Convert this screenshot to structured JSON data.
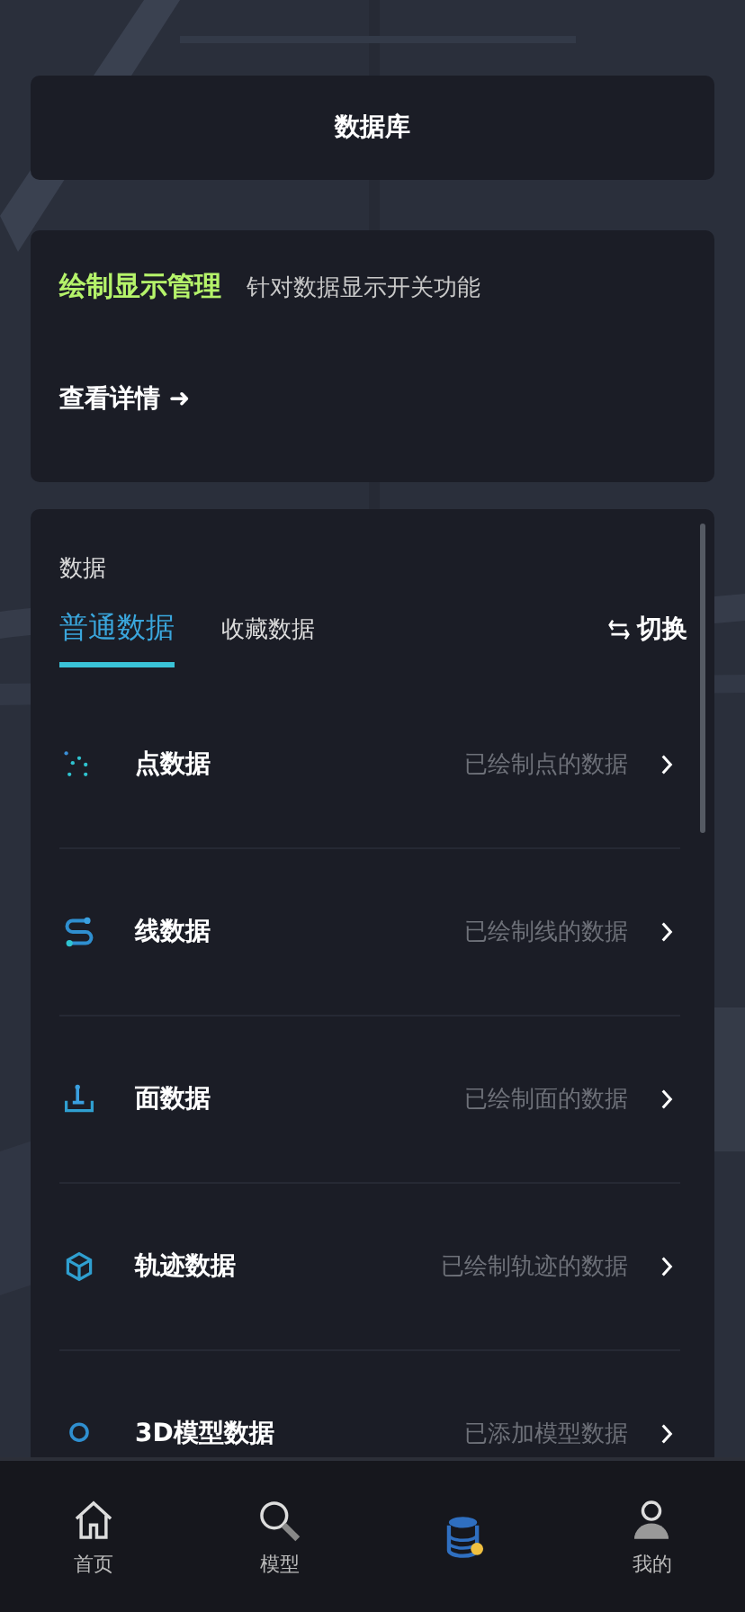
{
  "header": {
    "title": "数据库"
  },
  "banner": {
    "title": "绘制显示管理",
    "subtitle": "针对数据显示开关功能",
    "link": "查看详情",
    "arrow": "➜"
  },
  "panel": {
    "heading": "数据",
    "switch_label": "切换",
    "tabs": [
      {
        "label": "普通数据",
        "selected": true
      },
      {
        "label": "收藏数据",
        "selected": false
      }
    ],
    "items": [
      {
        "kind": "points",
        "name": "点数据",
        "note": "已绘制点的数据"
      },
      {
        "kind": "line",
        "name": "线数据",
        "note": "已绘制线的数据"
      },
      {
        "kind": "area",
        "name": "面数据",
        "note": "已绘制面的数据"
      },
      {
        "kind": "track",
        "name": "轨迹数据",
        "note": "已绘制轨迹的数据"
      },
      {
        "kind": "model",
        "name": "3D模型数据",
        "note": "已添加模型数据"
      }
    ]
  },
  "tab_bar": [
    {
      "kind": "home",
      "label": "首页",
      "selected": false
    },
    {
      "kind": "search",
      "label": "模型",
      "selected": false
    },
    {
      "kind": "database",
      "selected": true
    },
    {
      "kind": "user",
      "label": "我的",
      "selected": false
    }
  ]
}
